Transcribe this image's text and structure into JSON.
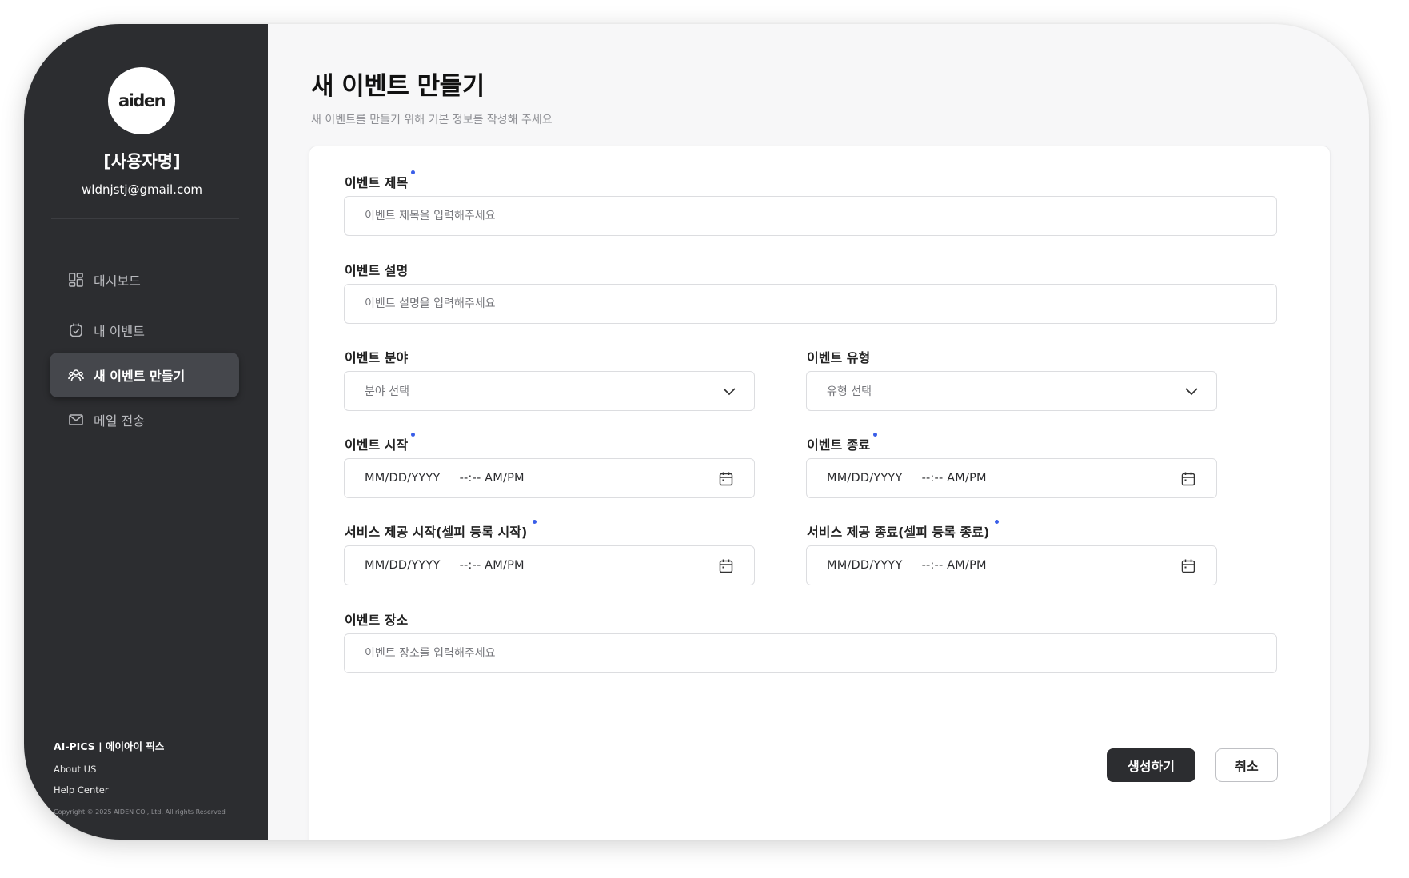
{
  "sidebar": {
    "logo_text": "aiden",
    "user_name": "[사용자명]",
    "user_email": "wldnjstj@gmail.com",
    "nav": [
      {
        "label": "대시보드",
        "icon": "dashboard-icon"
      },
      {
        "label": "내 이벤트",
        "icon": "calendar-check-icon"
      },
      {
        "label": "새 이벤트 만들기",
        "icon": "users-icon",
        "active": true
      },
      {
        "label": "메일 전송",
        "icon": "mail-icon"
      }
    ],
    "footer": {
      "brand": "AI-PICS | 에이아이 픽스",
      "about": "About US",
      "help": "Help Center",
      "copyright": "Copyright © 2025 AIDEN CO., Ltd. All rights  Reserved"
    }
  },
  "main": {
    "title": "새 이벤트 만들기",
    "subtitle": "새 이벤트를 만들기 위해 기본 정보를 작성해 주세요"
  },
  "form": {
    "title": {
      "label": "이벤트 제목",
      "placeholder": "이벤트 제목을 입력해주세요",
      "required": true
    },
    "description": {
      "label": "이벤트 설명",
      "placeholder": "이벤트 설명을 입력해주세요"
    },
    "category": {
      "label": "이벤트 분야",
      "value": "분야 선택"
    },
    "type": {
      "label": "이벤트 유형",
      "value": "유형 선택"
    },
    "start": {
      "label": "이벤트 시작",
      "date": "MM/DD/YYYY",
      "time": "--:-- AM/PM",
      "required": true
    },
    "end": {
      "label": "이벤트 종료",
      "date": "MM/DD/YYYY",
      "time": "--:-- AM/PM",
      "required": true
    },
    "service_start": {
      "label": "서비스 제공 시작(셀피 등록 시작)",
      "date": "MM/DD/YYYY",
      "time": "--:-- AM/PM",
      "required": true
    },
    "service_end": {
      "label": "서비스 제공 종료(셀피 등록 종료)",
      "date": "MM/DD/YYYY",
      "time": "--:-- AM/PM",
      "required": true
    },
    "location": {
      "label": "이벤트 장소",
      "placeholder": "이벤트 장소를 입력해주세요"
    }
  },
  "actions": {
    "create": "생성하기",
    "cancel": "취소"
  },
  "colors": {
    "sidebar_bg": "#2c2d30",
    "required_dot": "#3a5ee8",
    "primary_button": "#2c2d30"
  }
}
